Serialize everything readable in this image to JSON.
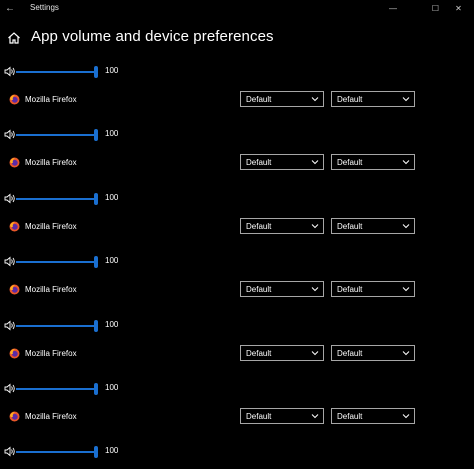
{
  "window": {
    "title": "Settings",
    "back_glyph": "←",
    "min_glyph": "—",
    "max_glyph": "☐",
    "close_glyph": "✕"
  },
  "header": {
    "icon": "home-icon",
    "title": "App volume and device preferences"
  },
  "apps": [
    {
      "name": "Mozilla Firefox",
      "volume": "100",
      "output": "Default",
      "input": "Default"
    },
    {
      "name": "Mozilla Firefox",
      "volume": "100",
      "output": "Default",
      "input": "Default"
    },
    {
      "name": "Mozilla Firefox",
      "volume": "100",
      "output": "Default",
      "input": "Default"
    },
    {
      "name": "Mozilla Firefox",
      "volume": "100",
      "output": "Default",
      "input": "Default"
    },
    {
      "name": "Mozilla Firefox",
      "volume": "100",
      "output": "Default",
      "input": "Default"
    },
    {
      "name": "Mozilla Firefox",
      "volume": "100",
      "output": "Default",
      "input": "Default"
    }
  ],
  "trailing_volume": {
    "volume": "100"
  },
  "colors": {
    "accent": "#1a6fd0",
    "background": "#000000",
    "border": "#a6a6a6"
  }
}
